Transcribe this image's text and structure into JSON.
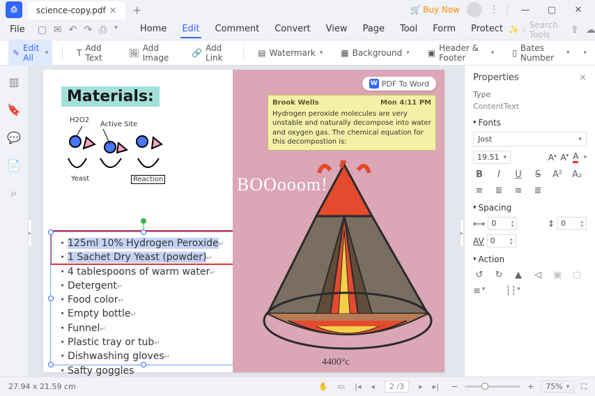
{
  "title": "science-copy.pdf",
  "buy": "Buy Now",
  "menus": {
    "file": "File"
  },
  "quick_icons": [
    "open",
    "mail",
    "undo",
    "redo",
    "print"
  ],
  "main_tabs": [
    "Home",
    "Edit",
    "Comment",
    "Convert",
    "View",
    "Page",
    "Tool",
    "Form",
    "Protect"
  ],
  "active_tab": "Edit",
  "search_placeholder": "Search Tools",
  "toolbar": {
    "edit_all": "Edit All",
    "add_text": "Add Text",
    "add_image": "Add Image",
    "add_link": "Add Link",
    "watermark": "Watermark",
    "background": "Background",
    "header_footer": "Header & Footer",
    "bates": "Bates Number"
  },
  "pdf2word": "PDF To Word",
  "document": {
    "materials_heading": "Materials:",
    "diagram_labels": {
      "h2o2": "H2O2",
      "active_site": "Active Site",
      "yeast": "Yeast",
      "reaction": "Reaction"
    },
    "list": [
      "125ml 10% Hydrogen Peroxide",
      "1 Sachet Dry Yeast (powder)",
      "4 tablespoons of warm water",
      "Detergent",
      "Food color",
      "Empty bottle",
      "Funnel",
      "Plastic tray or tub",
      "Dishwashing gloves",
      "Safty goggles"
    ],
    "boom": "BOOooom!",
    "temperature": "4400°c",
    "note": {
      "author": "Brook Wells",
      "time": "Mon 4:11 PM",
      "body": "Hydrogen peroxide molecules are very unstable and naturally decompose into water and oxygen gas. The chemical equation for this decompostion is:"
    }
  },
  "properties": {
    "title": "Properties",
    "type_label": "Type",
    "type_value": "ContentText",
    "sections": {
      "fonts": "Fonts",
      "spacing": "Spacing",
      "action": "Action"
    },
    "font_family": "Jost",
    "font_size": "19.51",
    "spacing_a": "0",
    "spacing_b": "0",
    "spacing_c": "0"
  },
  "status": {
    "dims": "27.94 x 21.59 cm",
    "page_current": "2",
    "page_total": "3",
    "zoom": "75%"
  }
}
